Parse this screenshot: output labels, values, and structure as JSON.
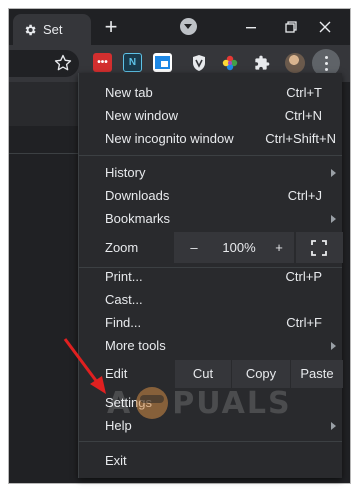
{
  "tab": {
    "title": "Set",
    "icon": "gear-icon"
  },
  "toolbar": {
    "icons": [
      "star-icon",
      "lastpass-icon",
      "n-extension-icon",
      "screenshot-icon",
      "vpn-shield-icon",
      "color-wheel-icon",
      "puzzle-icon",
      "avatar",
      "kebab-menu-icon"
    ]
  },
  "menu": {
    "new_tab": {
      "label": "New tab",
      "shortcut": "Ctrl+T"
    },
    "new_window": {
      "label": "New window",
      "shortcut": "Ctrl+N"
    },
    "new_incognito": {
      "label": "New incognito window",
      "shortcut": "Ctrl+Shift+N"
    },
    "history": {
      "label": "History"
    },
    "downloads": {
      "label": "Downloads",
      "shortcut": "Ctrl+J"
    },
    "bookmarks": {
      "label": "Bookmarks"
    },
    "zoom": {
      "label": "Zoom",
      "minus": "–",
      "value": "100%",
      "plus": "+"
    },
    "print": {
      "label": "Print...",
      "shortcut": "Ctrl+P"
    },
    "cast": {
      "label": "Cast..."
    },
    "find": {
      "label": "Find...",
      "shortcut": "Ctrl+F"
    },
    "more_tools": {
      "label": "More tools"
    },
    "edit": {
      "label": "Edit",
      "cut": "Cut",
      "copy": "Copy",
      "paste": "Paste"
    },
    "settings": {
      "label": "Settings"
    },
    "help": {
      "label": "Help"
    },
    "exit": {
      "label": "Exit"
    }
  },
  "watermark": {
    "text_a": "A",
    "text_b": "PUALS"
  },
  "colors": {
    "menu_bg": "#292a2d",
    "annotation_arrow": "#e02020"
  }
}
